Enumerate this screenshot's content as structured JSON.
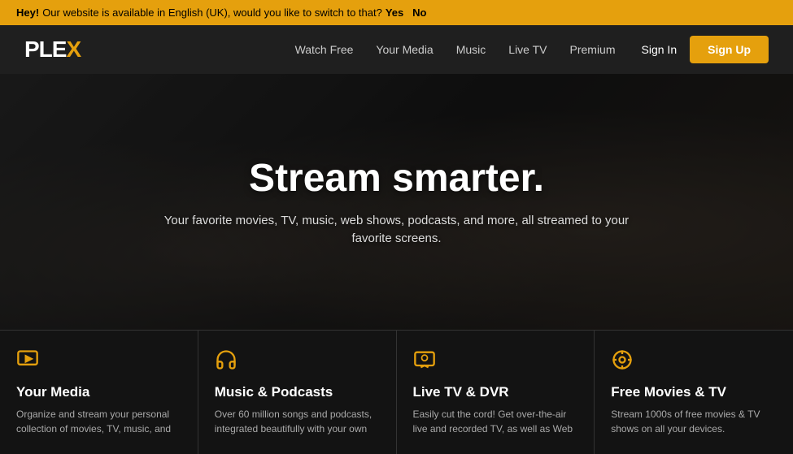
{
  "announcement": {
    "prefix": "Hey!",
    "message": "Our website is available in English (UK), would you like to switch to that?",
    "yes_label": "Yes",
    "no_label": "No"
  },
  "header": {
    "logo_text": "PLEX",
    "logo_x": "X",
    "nav": {
      "watch_free": "Watch Free",
      "your_media": "Your Media",
      "music": "Music",
      "live_tv": "Live TV",
      "premium": "Premium"
    },
    "sign_in": "Sign In",
    "sign_up": "Sign Up"
  },
  "hero": {
    "title": "Stream smarter.",
    "subtitle": "Your favorite movies, TV, music, web shows, podcasts, and more, all streamed to your favorite screens."
  },
  "features": [
    {
      "id": "your-media",
      "icon": "play-icon",
      "title": "Your Media",
      "description": "Organize and stream your personal collection of movies, TV, music, and"
    },
    {
      "id": "music-podcasts",
      "icon": "headphones-icon",
      "title": "Music & Podcasts",
      "description": "Over 60 million songs and podcasts, integrated beautifully with your own"
    },
    {
      "id": "live-tv",
      "icon": "tv-icon",
      "title": "Live TV & DVR",
      "description": "Easily cut the cord! Get over-the-air live and recorded TV, as well as Web"
    },
    {
      "id": "free-movies",
      "icon": "film-icon",
      "title": "Free Movies & TV",
      "description": "Stream 1000s of free movies & TV shows on all your devices."
    }
  ]
}
